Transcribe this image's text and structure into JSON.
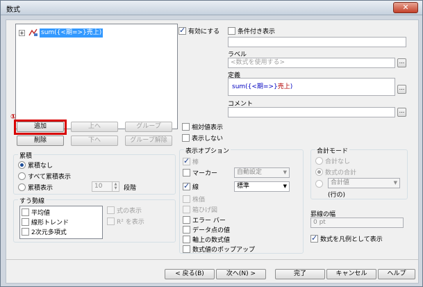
{
  "window": {
    "title": "数式",
    "close": "✕"
  },
  "tree": {
    "expander": "+",
    "item": {
      "prefix": "sum(",
      "field": "{<期=>}",
      "measure": "売上",
      "suffix": ")"
    }
  },
  "buttons": {
    "add": "追加",
    "up": "上へ",
    "group": "グループ",
    "delete": "削除",
    "down": "下へ",
    "ungroup": "グループ解除"
  },
  "annotation": {
    "marker": "①"
  },
  "enable": {
    "label": "有効にする",
    "checked": true
  },
  "conditional": {
    "label": "条件付き表示",
    "checked": false
  },
  "label_field": {
    "title": "ラベル",
    "placeholder": "<数式を使用する>",
    "browse": "..."
  },
  "definition": {
    "title": "定義",
    "prefix": "sum(",
    "field": "{<期=>}",
    "measure": "売上",
    "suffix": ")",
    "browse": "..."
  },
  "comment": {
    "title": "コメント",
    "value": "",
    "browse": "..."
  },
  "relative": {
    "label": "相対値表示",
    "checked": false
  },
  "hide": {
    "label": "表示しない",
    "checked": false
  },
  "accumulation": {
    "title": "累積",
    "options": [
      "累積なし",
      "すべて累積表示",
      "累積表示"
    ],
    "selected": 0,
    "steps_value": "10",
    "steps_label": "段階"
  },
  "trendlines": {
    "title": "すう勢線",
    "items": [
      "平均値",
      "線形トレンド",
      "2次元多項式"
    ],
    "show_formula": "式の表示",
    "show_r2": "R² を表示"
  },
  "display_options": {
    "title": "表示オプション",
    "items": [
      {
        "label": "棒",
        "checked": true,
        "disabled": true
      },
      {
        "label": "マーカー",
        "checked": false,
        "disabled": false
      },
      {
        "label": "線",
        "checked": true,
        "disabled": false
      },
      {
        "label": "株価",
        "checked": false,
        "disabled": true
      },
      {
        "label": "箱ひげ図",
        "checked": false,
        "disabled": true
      },
      {
        "label": "エラー バー",
        "checked": false,
        "disabled": false
      },
      {
        "label": "データ点の値",
        "checked": false,
        "disabled": false
      },
      {
        "label": "軸上の数式値",
        "checked": false,
        "disabled": false
      },
      {
        "label": "数式値のポップアップ",
        "checked": false,
        "disabled": false
      }
    ],
    "marker_select": "自動設定",
    "line_select": "標準"
  },
  "total_mode": {
    "title": "合計モード",
    "options": [
      "合計なし",
      "数式の合計"
    ],
    "selected": 1,
    "agg_select": "合計値",
    "agg_suffix": "(行の)"
  },
  "line_width": {
    "title": "罫線の幅",
    "value": "0 pt"
  },
  "legend": {
    "label": "数式を凡例として表示",
    "checked": true
  },
  "footer": {
    "back": "< 戻る(B)",
    "next": "次へ(N) >",
    "finish": "完了",
    "cancel": "キャンセル",
    "help": "ヘルプ"
  },
  "colors": {
    "selection": "#3399ff",
    "highlight": "#d80000",
    "formula_field": "#0000c0",
    "formula_measure": "#b00000"
  }
}
